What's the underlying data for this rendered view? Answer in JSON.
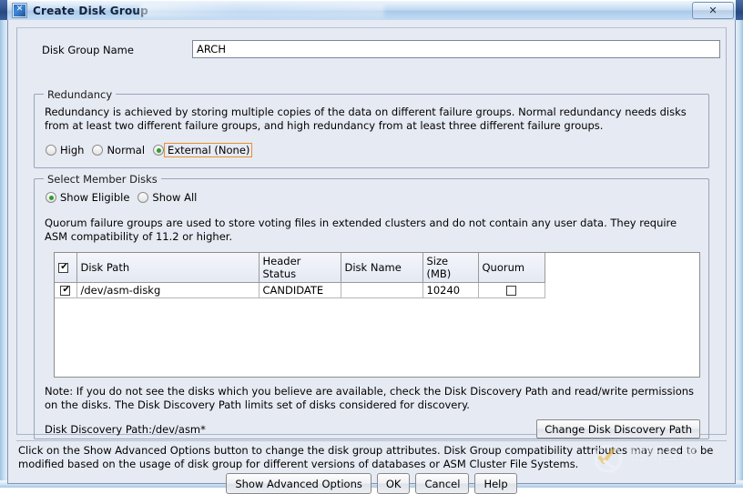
{
  "window": {
    "title": "Create Disk Group",
    "icon": "disk-group-icon",
    "close_label": "✕",
    "background_window_title": ""
  },
  "form": {
    "disk_group_name_label": "Disk Group Name",
    "disk_group_name_value": "ARCH",
    "disk_group_name_placeholder": ""
  },
  "redundancy": {
    "group_title": "Redundancy",
    "description": "Redundancy is achieved by storing multiple copies of the data on different failure groups. Normal redundancy needs disks from at least two different failure groups, and high redundancy from at least three different failure groups.",
    "options": [
      {
        "label": "High",
        "checked": false,
        "focused": false
      },
      {
        "label": "Normal",
        "checked": false,
        "focused": false
      },
      {
        "label": "External (None)",
        "checked": true,
        "focused": true
      }
    ],
    "focus_color": "#e8922a",
    "selected_dot_color": "#2f9e2f"
  },
  "members": {
    "group_title": "Select Member Disks",
    "filter_options": [
      {
        "label": "Show Eligible",
        "checked": true
      },
      {
        "label": "Show All",
        "checked": false
      }
    ],
    "quorum_description": "Quorum failure groups are used to store voting files in extended clusters and do not contain any user data. They require ASM compatibility of 11.2 or higher.",
    "table": {
      "select_all_checked": true,
      "columns": [
        "",
        "Disk Path",
        "Header Status",
        "Disk Name",
        "Size (MB)",
        "Quorum"
      ],
      "rows": [
        {
          "selected": true,
          "disk_path": "/dev/asm-diskg",
          "header_status": "CANDIDATE",
          "disk_name": "",
          "size_mb": "10240",
          "quorum": false
        }
      ]
    },
    "note": "Note: If you do not see the disks which you believe are available, check the Disk Discovery Path and read/write permissions on the disks. The Disk Discovery Path limits set of disks considered for discovery.",
    "discovery_path_label": "Disk Discovery Path:/dev/asm*",
    "change_path_button": "Change Disk Discovery Path"
  },
  "footer": {
    "description": "Click on the Show Advanced Options button to change the disk group attributes. Disk Group compatibility attributes may need to be modified based on the usage of disk group for different versions of databases or ASM Cluster File Systems.",
    "buttons": [
      {
        "label": "Show Advanced Options"
      },
      {
        "label": "OK"
      },
      {
        "label": "Cancel"
      },
      {
        "label": "Help"
      }
    ]
  },
  "watermark": {
    "chinese": "创新互联",
    "pinyin": "CHUANG XIN HU LIAN"
  }
}
